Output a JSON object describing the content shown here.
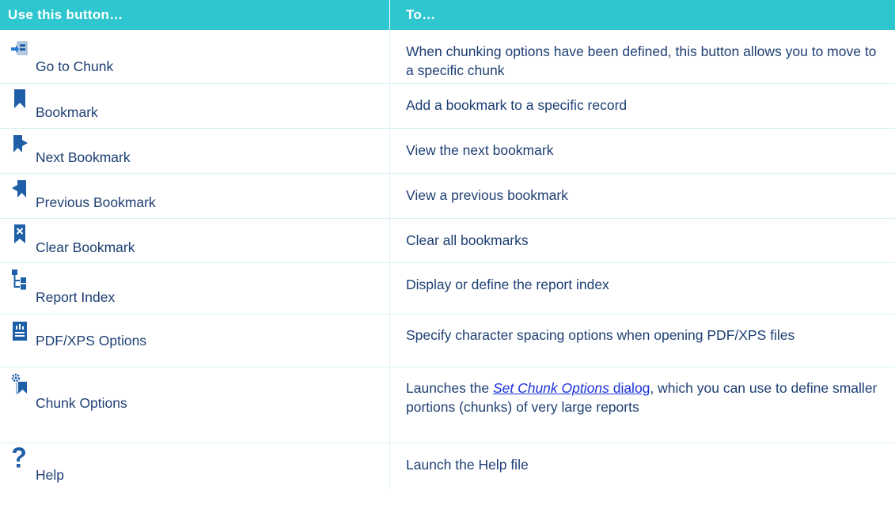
{
  "header": {
    "col1": "Use this button…",
    "col2": "To…"
  },
  "rows": [
    {
      "button": "Go to Chunk",
      "icon": "go-to-chunk-icon",
      "description": "When chunking options have been defined, this button allows you to move to a specific chunk"
    },
    {
      "button": "Bookmark",
      "icon": "bookmark-icon",
      "description": "Add a bookmark to a specific record"
    },
    {
      "button": "Next Bookmark",
      "icon": "next-bookmark-icon",
      "description": "View the next bookmark"
    },
    {
      "button": "Previous Bookmark",
      "icon": "previous-bookmark-icon",
      "description": "View a previous bookmark"
    },
    {
      "button": "Clear Bookmark",
      "icon": "clear-bookmark-icon",
      "description": "Clear all bookmarks"
    },
    {
      "button": "Report Index",
      "icon": "report-index-icon",
      "description": "Display or define the report index"
    },
    {
      "button": "PDF/XPS Options",
      "icon": "pdf-xps-options-icon",
      "description": "Specify character spacing options when opening PDF/XPS files"
    },
    {
      "button": "Chunk Options",
      "icon": "chunk-options-icon",
      "description_prefix": "Launches the ",
      "link_italic": "Set Chunk Options",
      "link_rest": " dialog",
      "description_suffix": ", which you can use to define smaller portions (chunks) of very large reports"
    },
    {
      "button": "Help",
      "icon": "help-icon",
      "description": "Launch the Help file"
    }
  ],
  "colors": {
    "header_bg": "#2ec6cf",
    "text": "#1d3f73",
    "icon_blue": "#1e5fa8",
    "link": "#1b32d9"
  }
}
